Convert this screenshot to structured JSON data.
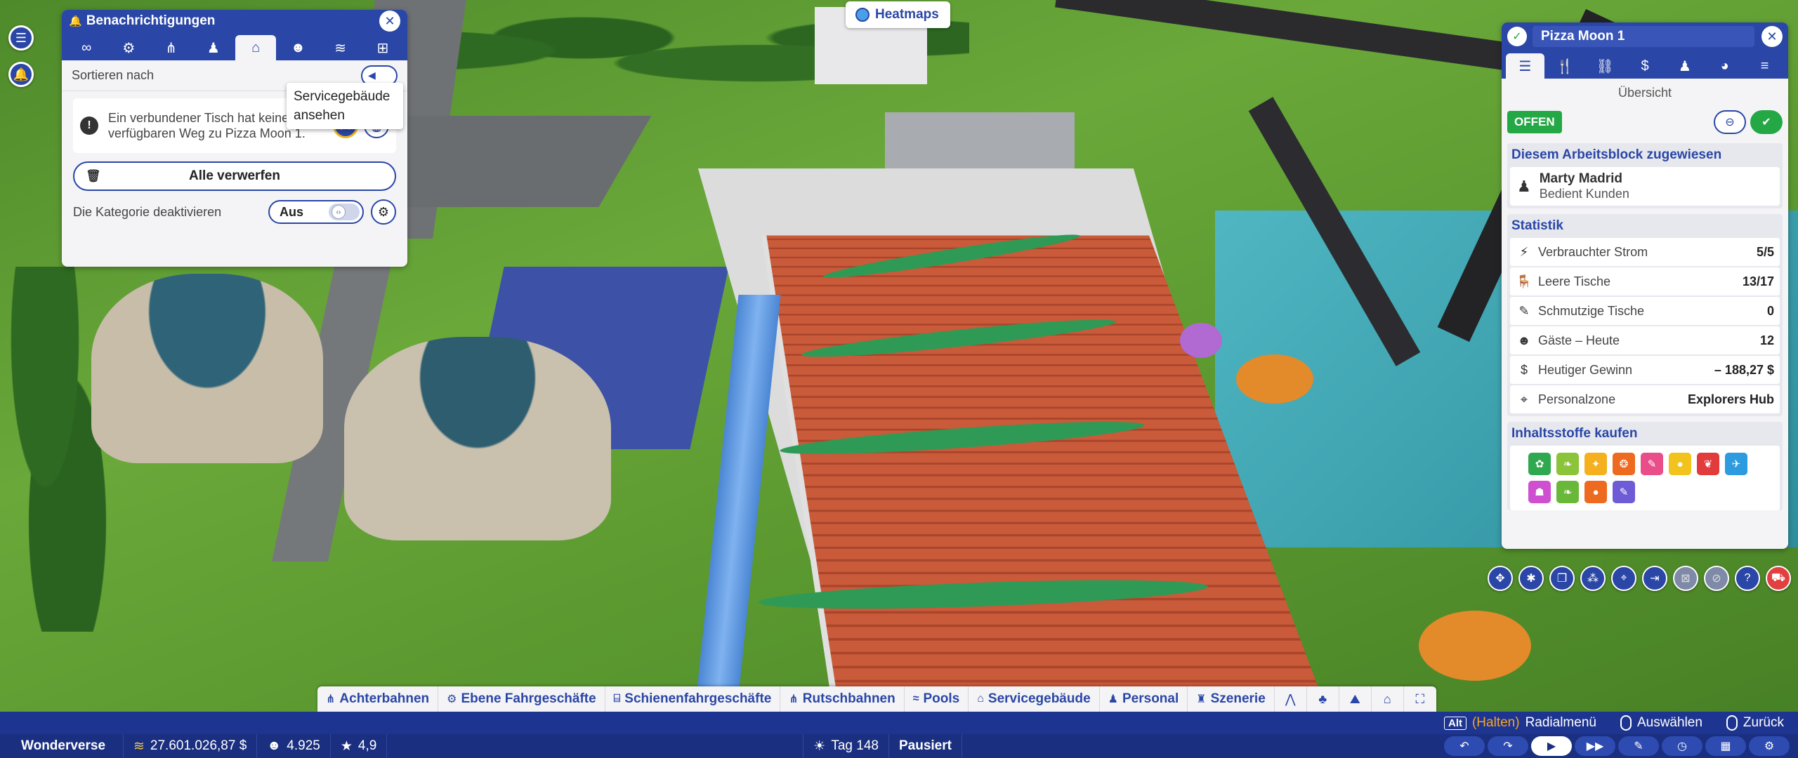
{
  "notifications": {
    "title": "Benachrichtigungen",
    "tabs": [
      {
        "name": "tab-all",
        "glyph": "∞"
      },
      {
        "name": "tab-rides",
        "glyph": "⚙"
      },
      {
        "name": "tab-coasters",
        "glyph": "⋔"
      },
      {
        "name": "tab-staff",
        "glyph": "♟"
      },
      {
        "name": "tab-facilities",
        "glyph": "⌂"
      },
      {
        "name": "tab-guests",
        "glyph": "☻"
      },
      {
        "name": "tab-finance",
        "glyph": "≋"
      },
      {
        "name": "tab-misc",
        "glyph": "⊞"
      }
    ],
    "sort_label": "Sortieren nach",
    "item_text": "Ein verbundener Tisch hat keinen verfügbaren Weg zu Pizza Moon 1.",
    "dismiss_all_label": "Alle verwerfen",
    "disable_category_label": "Die Kategorie deaktivieren",
    "toggle_value": "Aus"
  },
  "tooltip": {
    "text": "Servicegebäude ansehen"
  },
  "heatmaps": {
    "label": "Heatmaps"
  },
  "info_panel": {
    "title": "Pizza Moon 1",
    "section": "Übersicht",
    "status": "OFFEN",
    "assigned_title": "Diesem Arbeitsblock zugewiesen",
    "assignee_name": "Marty Madrid",
    "assignee_role": "Bedient Kunden",
    "stats_title": "Statistik",
    "stats": [
      {
        "label": "Verbrauchter Strom",
        "value": "5/5",
        "icon": "⚡"
      },
      {
        "label": "Leere Tische",
        "value": "13/17",
        "icon": "🪑"
      },
      {
        "label": "Schmutzige Tische",
        "value": "0",
        "icon": "✎"
      },
      {
        "label": "Gäste – Heute",
        "value": "12",
        "icon": "☻"
      },
      {
        "label": "Heutiger Gewinn",
        "value": "– 188,27 $",
        "icon": "$"
      },
      {
        "label": "Personalzone",
        "value": "Explorers Hub",
        "icon": "⌖"
      }
    ],
    "ingredients_title": "Inhaltsstoffe kaufen",
    "ingredient_colors": [
      "#2fa84f",
      "#8bc43a",
      "#f5b01f",
      "#ee6a1f",
      "#e94e8a",
      "#f2c31c",
      "#e23b3b",
      "#2c9be0",
      "#cf4fd1",
      "#6ab83a",
      "#ee6a1f",
      "#6d5cd6"
    ]
  },
  "build_bar": {
    "categories": [
      {
        "label": "Achterbahnen",
        "icon": "⋔"
      },
      {
        "label": "Ebene Fahrgeschäfte",
        "icon": "⚙"
      },
      {
        "label": "Schienenfahrgeschäfte",
        "icon": "⌸"
      },
      {
        "label": "Rutschbahnen",
        "icon": "⋔"
      },
      {
        "label": "Pools",
        "icon": "≈"
      },
      {
        "label": "Servicegebäude",
        "icon": "⌂"
      },
      {
        "label": "Personal",
        "icon": "♟"
      },
      {
        "label": "Szenerie",
        "icon": "♜"
      }
    ]
  },
  "controls_hint": {
    "key": "Alt",
    "hold": "(Halten)",
    "radial": "Radialmenü",
    "select": "Auswählen",
    "back": "Zurück"
  },
  "status_bar": {
    "park_name": "Wonderverse",
    "money": "27.601.026,87 $",
    "guests": "4.925",
    "rating": "4,9",
    "day": "Tag 148",
    "state": "Pausiert"
  }
}
